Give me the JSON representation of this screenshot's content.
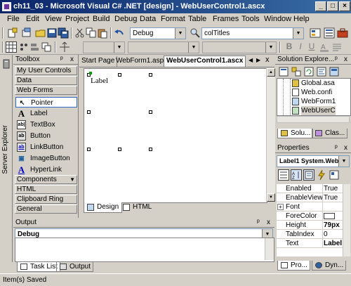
{
  "window": {
    "title": "ch11_03 - Microsoft Visual C# .NET [design] - WebUserControl1.ascx",
    "buttons": {
      "minimize": "_",
      "maximize": "□",
      "close": "×"
    }
  },
  "menu": {
    "items": [
      "File",
      "Edit",
      "View",
      "Project",
      "Build",
      "Debug",
      "Data",
      "Format",
      "Table",
      "Frames",
      "Tools",
      "Window",
      "Help"
    ]
  },
  "toolbar": {
    "config_combo": "Debug",
    "find_combo": "colTitles"
  },
  "side_tab": {
    "label": "Server Explorer"
  },
  "toolbox": {
    "title": "Toolbox",
    "pin": "ᵖ",
    "close": "x",
    "categories": [
      "My User Controls",
      "Data",
      "Web Forms"
    ],
    "items": [
      {
        "label": "Pointer",
        "icon": "pointer-icon",
        "glyph": "↖"
      },
      {
        "label": "Label",
        "icon": "label-icon",
        "glyph": "A"
      },
      {
        "label": "TextBox",
        "icon": "textbox-icon",
        "glyph": "ab|"
      },
      {
        "label": "Button",
        "icon": "button-icon",
        "glyph": "ab"
      },
      {
        "label": "LinkButton",
        "icon": "linkbutton-icon",
        "glyph": "ab"
      },
      {
        "label": "ImageButton",
        "icon": "imagebutton-icon",
        "glyph": "▣"
      },
      {
        "label": "HyperLink",
        "icon": "hyperlink-icon",
        "glyph": "A"
      }
    ],
    "bottom_categories": [
      "Components",
      "HTML",
      "Clipboard Ring",
      "General"
    ]
  },
  "editor": {
    "tabs": [
      "Start Page",
      "WebForm1.aspx",
      "WebUserControl1.ascx"
    ],
    "active_tab": "WebUserControl1.ascx",
    "design_label_text": "Label",
    "view_tabs": [
      "Design",
      "HTML"
    ],
    "active_view": "Design",
    "scroll_up": "▲",
    "scroll_down": "▼",
    "nav_left": "◀",
    "nav_right": "▶",
    "close": "x"
  },
  "output": {
    "title": "Output",
    "combo_value": "Debug"
  },
  "bottom_tabs": [
    "Task List",
    "Output"
  ],
  "solution_explorer": {
    "title": "Solution Explore...",
    "items": [
      "Global.asa",
      "Web.confi",
      "WebForm1",
      "WebUserC"
    ],
    "tabs": [
      "Solu...",
      "Clas..."
    ]
  },
  "properties": {
    "title": "Properties",
    "object": "Label1  System.Web",
    "rows": [
      {
        "name": "Enabled",
        "value": "True"
      },
      {
        "name": "EnableViewSt",
        "value": "True"
      },
      {
        "name": "Font",
        "value": ""
      },
      {
        "name": "ForeColor",
        "value": ""
      },
      {
        "name": "Height",
        "value": "79px"
      },
      {
        "name": "TabIndex",
        "value": "0"
      },
      {
        "name": "Text",
        "value": "Label"
      }
    ],
    "tabs": [
      "Pro...",
      "Dyn..."
    ]
  },
  "status": {
    "text": "Item(s) Saved"
  },
  "colors": {
    "title_gradient_start": "#0a246a",
    "title_gradient_end": "#3a6ea5",
    "chrome": "#d4d0c8",
    "selection": "#316ac5"
  }
}
